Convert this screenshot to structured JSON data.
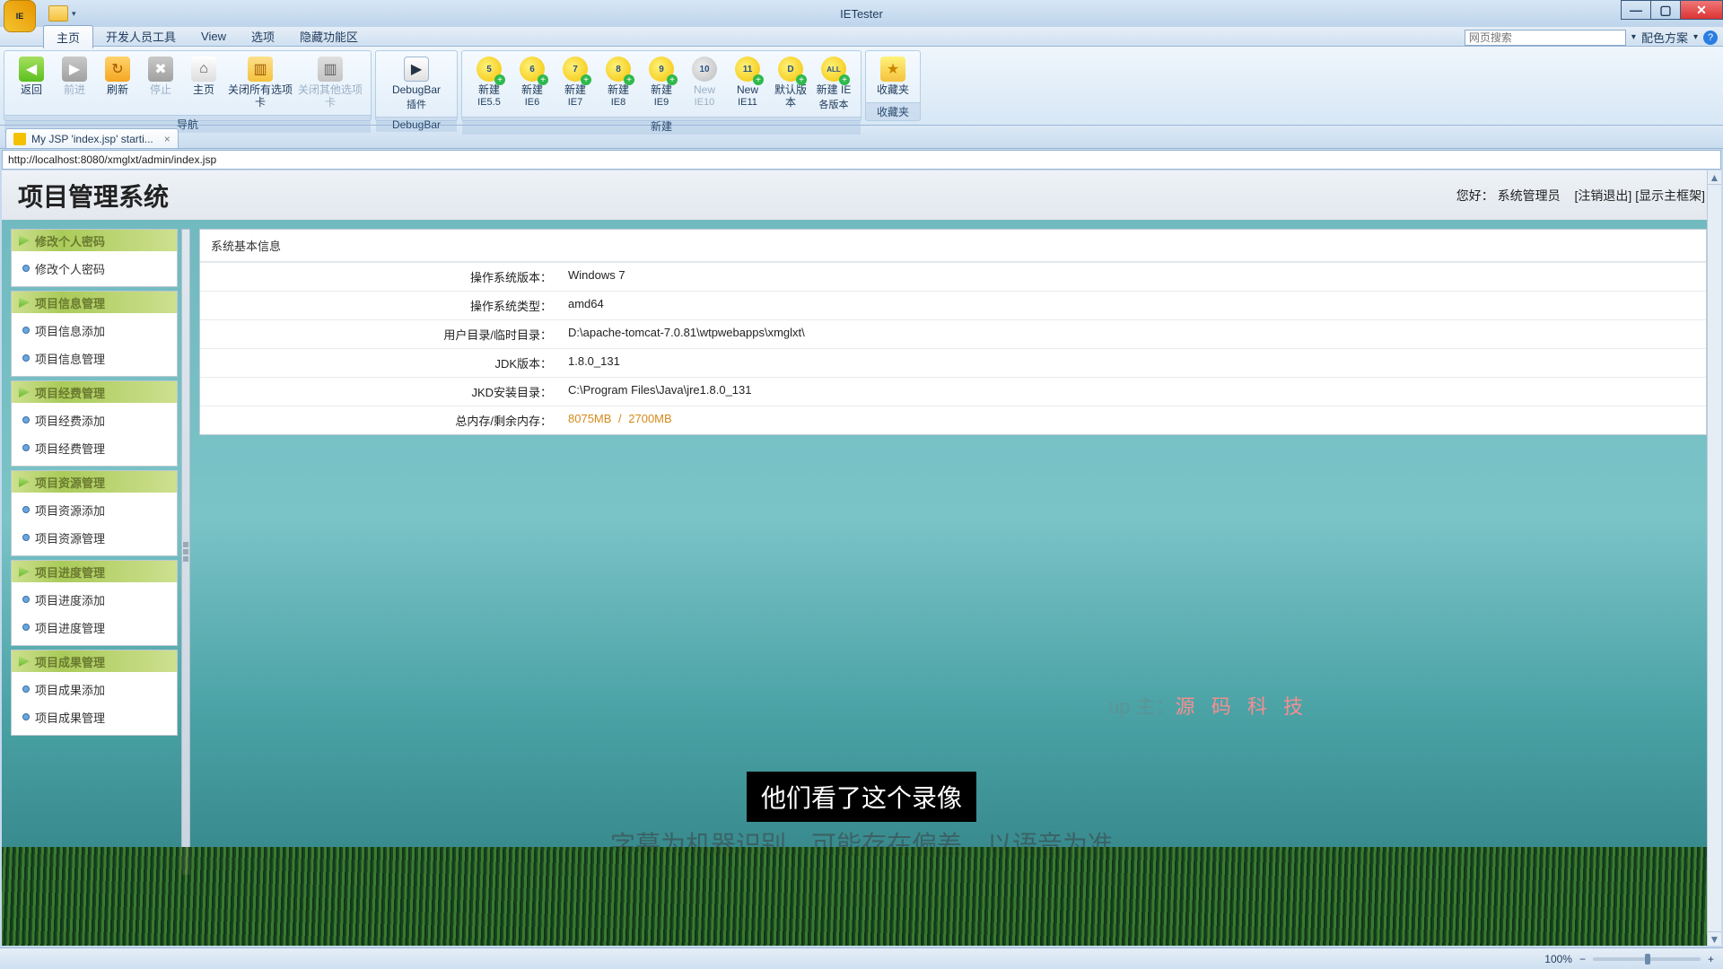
{
  "app": {
    "title": "IETester"
  },
  "menus": {
    "m1": "主页",
    "m2": "开发人员工具",
    "m3": "View",
    "m4": "选项",
    "m5": "隐藏功能区"
  },
  "search": {
    "placeholder": "网页搜索",
    "scheme": "配色方案"
  },
  "ribbon": {
    "back": "返回",
    "forward": "前进",
    "refresh": "刷新",
    "stop": "停止",
    "home": "主页",
    "closeAll": "关闭所有选项卡",
    "closeOther": "关闭其他选项卡",
    "navGroup": "导航",
    "debugbar": "DebugBar",
    "debugbarSub": "插件",
    "debugbarGroup": "DebugBar",
    "ie55a": "新建",
    "ie55b": "IE5.5",
    "ie6a": "新建",
    "ie6b": "IE6",
    "ie7a": "新建",
    "ie7b": "IE7",
    "ie8a": "新建",
    "ie8b": "IE8",
    "ie9a": "新建",
    "ie9b": "IE9",
    "ie10a": "New",
    "ie10b": "IE10",
    "ie11a": "New",
    "ie11b": "IE11",
    "def": "默认版本",
    "alla": "新建 IE",
    "allb": "各版本",
    "newGroup": "新建",
    "fav": "收藏夹",
    "favGroup": "收藏夹"
  },
  "tab": {
    "title": "My JSP 'index.jsp' starti..."
  },
  "address": "http://localhost:8080/xmglxt/admin/index.jsp",
  "page": {
    "title": "项目管理系统",
    "greeting": "您好：",
    "username": "系统管理员",
    "logout": "[注销退出]",
    "frame": "[显示主框架]"
  },
  "sidebar": {
    "g1": {
      "hd": "修改个人密码",
      "i1": "修改个人密码"
    },
    "g2": {
      "hd": "项目信息管理",
      "i1": "项目信息添加",
      "i2": "项目信息管理"
    },
    "g3": {
      "hd": "项目经费管理",
      "i1": "项目经费添加",
      "i2": "项目经费管理"
    },
    "g4": {
      "hd": "项目资源管理",
      "i1": "项目资源添加",
      "i2": "项目资源管理"
    },
    "g5": {
      "hd": "项目进度管理",
      "i1": "项目进度添加",
      "i2": "项目进度管理"
    },
    "g6": {
      "hd": "项目成果管理",
      "i1": "项目成果添加",
      "i2": "项目成果管理"
    }
  },
  "panel": {
    "title": "系统基本信息",
    "k1": "操作系统版本：",
    "v1": "Windows 7",
    "k2": "操作系统类型：",
    "v2": "amd64",
    "k3": "用户目录/临时目录：",
    "v3": "D:\\apache-tomcat-7.0.81\\wtpwebapps\\xmglxt\\",
    "k4": "JDK版本：",
    "v4": "1.8.0_131",
    "k5": "JKD安装目录：",
    "v5": "C:\\Program Files\\Java\\jre1.8.0_131",
    "k6": "总内存/剩余内存：",
    "v6a": "8075MB",
    "v6sep": " / ",
    "v6b": "2700MB"
  },
  "overlay": {
    "wm1": "up 主：",
    "wm2": "源 码 科 技",
    "sub1": "他们看了这个录像",
    "sub2": "字幕为机器识别，可能存在偏差，以语音为准"
  },
  "status": {
    "zoom": "100%"
  }
}
